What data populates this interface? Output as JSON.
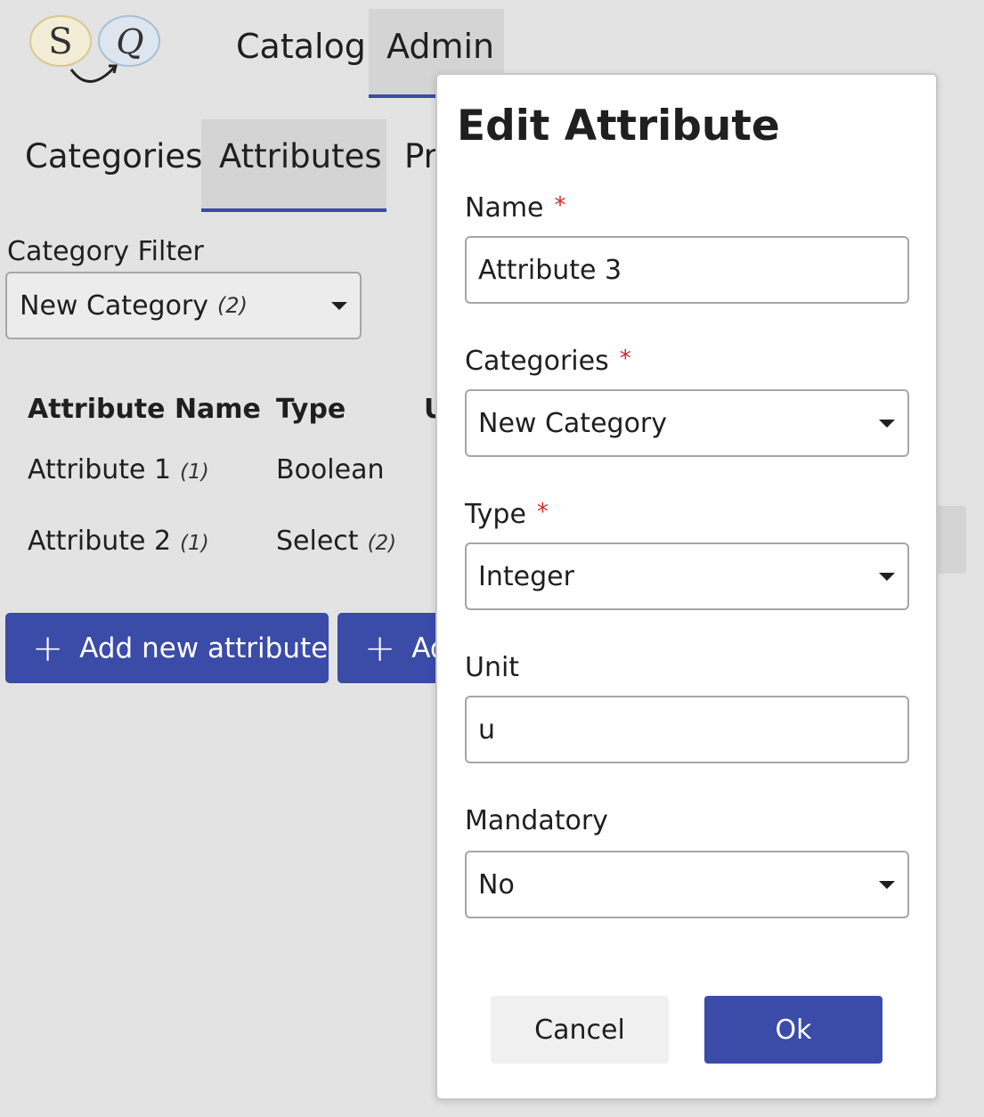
{
  "logo": {
    "letter_left": "S",
    "letter_right": "Q"
  },
  "topnav": {
    "catalog": "Catalog",
    "admin": "Admin"
  },
  "subnav": {
    "categories": "Categories",
    "attributes": "Attributes",
    "products_partial": "Pr"
  },
  "filter": {
    "label": "Category Filter",
    "value": "New Category",
    "count": "(2)"
  },
  "table": {
    "headers": [
      "Attribute Name",
      "Type",
      "U"
    ],
    "rows": [
      {
        "name": "Attribute 1",
        "name_count": "(1)",
        "type": "Boolean",
        "type_count": ""
      },
      {
        "name": "Attribute 2",
        "name_count": "(1)",
        "type": "Select",
        "type_count": "(2)"
      }
    ]
  },
  "actions": {
    "add_attribute": "Add new attribute",
    "add_second_partial": "Ad",
    "plus": "+"
  },
  "dialog": {
    "title": "Edit Attribute",
    "required_mark": "*",
    "fields": {
      "name": {
        "label": "Name",
        "value": "Attribute 3"
      },
      "categories": {
        "label": "Categories",
        "value": "New Category"
      },
      "type": {
        "label": "Type",
        "value": "Integer"
      },
      "unit": {
        "label": "Unit",
        "value": "u"
      },
      "mandatory": {
        "label": "Mandatory",
        "value": "No"
      }
    },
    "cancel": "Cancel",
    "ok": "Ok"
  },
  "colors": {
    "primary": "#3b4ba8",
    "background": "#e3e3e3",
    "selected_tab": "#d4d4d4",
    "required": "#cc2a2a"
  }
}
